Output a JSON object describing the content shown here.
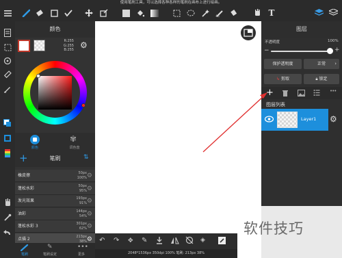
{
  "topbar": {
    "hint": "使用笔刷工具，可以选择各种各样的笔刷在画布上进行绘画。",
    "text_tool_label": "T"
  },
  "color_panel": {
    "title": "颜色",
    "rgb_r": "R:255",
    "rgb_g": "G:255",
    "rgb_b": "B:255",
    "tab_color": "颜色",
    "tab_palette": "调色盘"
  },
  "brush_panel": {
    "title": "笔刷",
    "items": [
      {
        "name": "橡皮擦",
        "size": "50px",
        "opacity": "100%"
      },
      {
        "name": "蓬松水彩",
        "size": "50px",
        "opacity": "95%"
      },
      {
        "name": "发光效果",
        "size": "193px",
        "opacity": "91%"
      },
      {
        "name": "油彩",
        "size": "144px",
        "opacity": "54%"
      },
      {
        "name": "蓬松水彩 3",
        "size": "301px",
        "opacity": "62%"
      },
      {
        "name": "点描 2",
        "size": "213px",
        "opacity": "38%"
      }
    ]
  },
  "left_tabs": {
    "brush": "笔刷",
    "brush_settings": "笔刷设定",
    "more": "更多"
  },
  "layer_panel": {
    "title": "图层",
    "opacity_label": "不透明度",
    "opacity_value": "100%",
    "protect_alpha": "保护透明度",
    "blend_mode": "正常",
    "clip": "剪取",
    "lock": "锁定",
    "list_title": "图层列表",
    "layer_name": "Layer1"
  },
  "status": {
    "text": "2048*1536px 350dpi 100% 笔刷: 213px 38%"
  },
  "watermark": {
    "text": "软件技巧"
  },
  "colors": {
    "accent": "#1d8fdc",
    "panel": "#333333",
    "canvas": "#ffffff",
    "selected_color": "#ffffff",
    "arrow": "#e03030"
  }
}
